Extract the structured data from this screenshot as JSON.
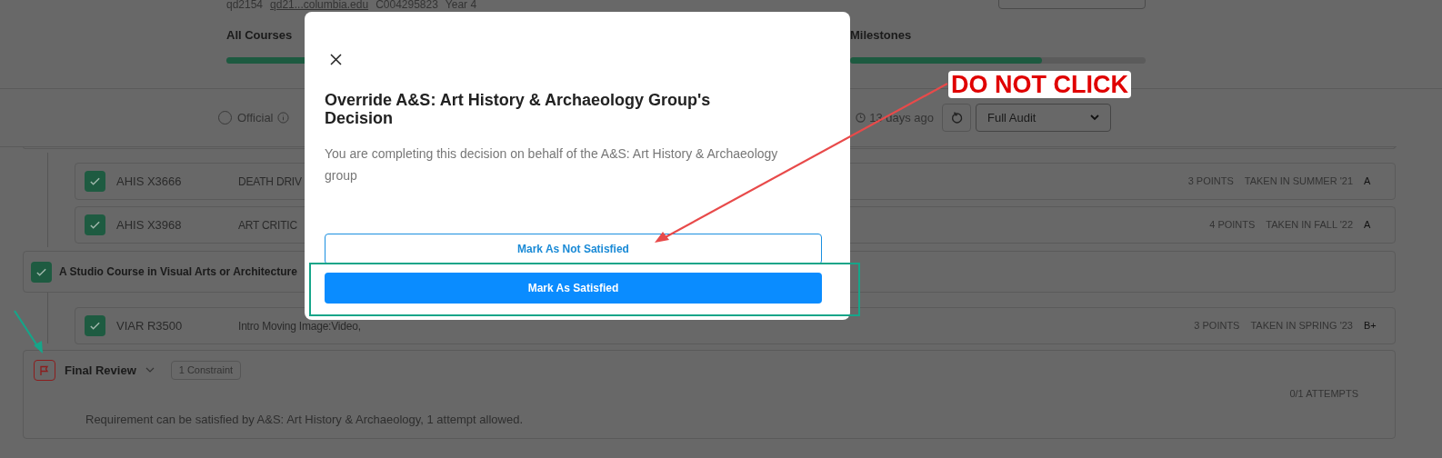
{
  "header": {
    "student_id": "qd2154",
    "email": "qd21...columbia.edu",
    "student_number": "C004295823",
    "year": "Year 4"
  },
  "progress": [
    {
      "label": "All Courses",
      "level": 1
    },
    {
      "label": "Milestones",
      "level": 0.65
    }
  ],
  "toolbar": {
    "official_label": "Official",
    "official_selected": false,
    "updated": "13 days ago",
    "view_select": "Full Audit"
  },
  "course_rows": [
    {
      "code": "AHIS X3666",
      "title": "DEATH DRIV",
      "points": "3 POINTS",
      "term": "TAKEN IN SUMMER '21",
      "grade": "A",
      "checked": true
    },
    {
      "code": "AHIS X3968",
      "title": "ART CRITIC",
      "points": "4 POINTS",
      "term": "TAKEN IN FALL '22",
      "grade": "A",
      "checked": true
    }
  ],
  "requirement": {
    "title": "A Studio Course in Visual Arts or Architecture",
    "checked": true,
    "courses": [
      {
        "code": "VIAR R3500",
        "title": "Intro Moving Image:Video,",
        "points": "3 POINTS",
        "term": "TAKEN IN SPRING '23",
        "grade": "B+",
        "checked": true
      }
    ]
  },
  "final_review": {
    "title": "Final Review",
    "expanded": false,
    "badge": "1 Constraint",
    "attempts": "0/1 ATTEMPTS",
    "description": "Requirement can be satisfied by A&S: Art History & Archaeology, 1 attempt allowed."
  },
  "modal": {
    "title": "Override A&S: Art History & Archaeology Group's Decision",
    "description": "You are completing this decision on behalf of the A&S: Art History & Archaeology group",
    "buttons": [
      {
        "label": "Mark As Not Satisfied",
        "kind": "outline"
      },
      {
        "label": "Mark As Satisfied",
        "kind": "primary"
      }
    ]
  },
  "annotation": {
    "callout": "DO NOT CLICK"
  }
}
